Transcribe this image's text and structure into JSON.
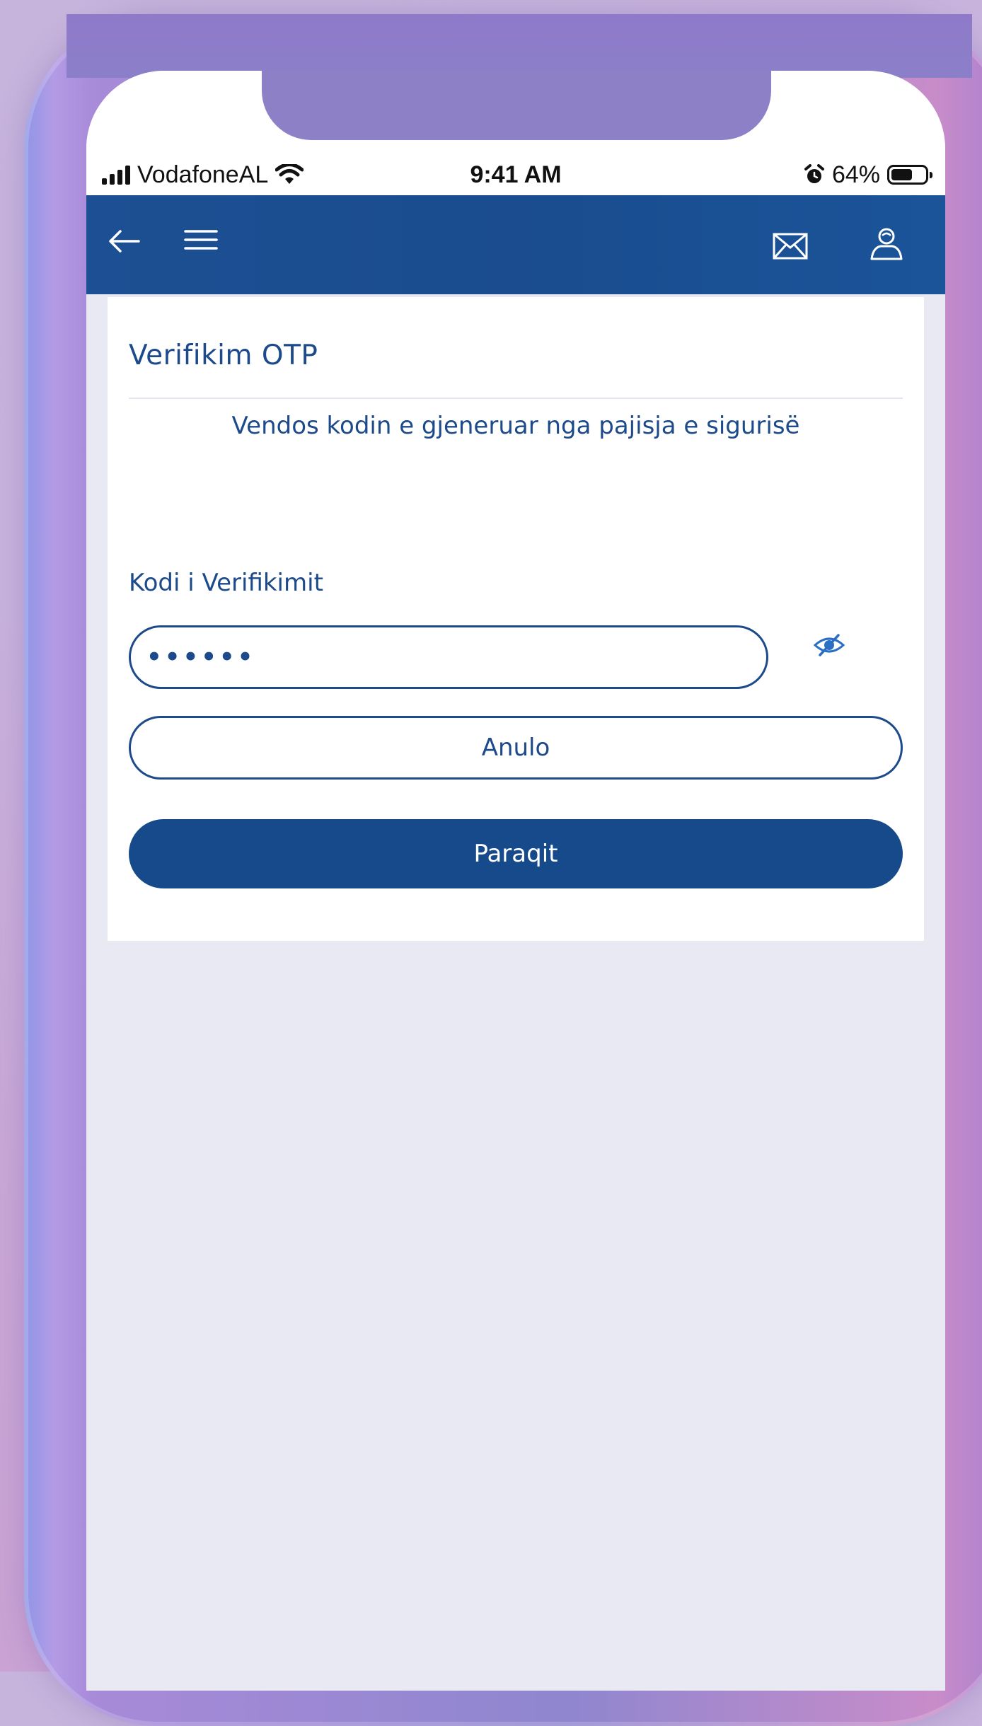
{
  "status_bar": {
    "carrier": "VodafoneAL",
    "time": "9:41 AM",
    "battery_percent": "64%",
    "battery_level": 0.64,
    "icons": [
      "signal-icon",
      "wifi-icon",
      "alarm-icon",
      "battery-icon"
    ]
  },
  "header": {
    "icons": [
      "back-arrow-icon",
      "hamburger-menu-icon",
      "mail-icon",
      "user-profile-icon"
    ]
  },
  "card": {
    "title": "Verifikim OTP",
    "subtitle": "Vendos kodin e gjeneruar nga pajisja e sigurisë",
    "field_label": "Kodi i Verifikimit",
    "field_value": "••••••",
    "cancel_label": "Anulo",
    "submit_label": "Paraqit",
    "toggle_icon": "eye-slash-icon"
  },
  "colors": {
    "brand_blue": "#1c4a8a",
    "header_blue": "#1b4f93",
    "page_background": "#e8e9f2",
    "card_background": "#ffffff"
  }
}
